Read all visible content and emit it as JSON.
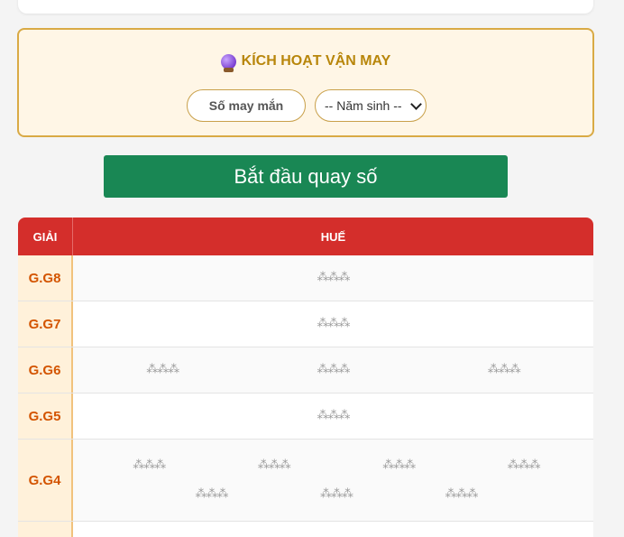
{
  "lucky": {
    "title": "KÍCH HOẠT VẬN MAY",
    "icon": "crystal-ball-icon",
    "lucky_number_placeholder": "Số may mắn",
    "birth_year_selected": "-- Năm sinh --"
  },
  "spin_button_label": "Bắt đầu quay số",
  "results": {
    "col_prize": "GIẢI",
    "col_province": "HUẾ",
    "loading_glyph": "⁂⁂⁂",
    "rows": [
      {
        "prize": "G.G8",
        "slots": 1
      },
      {
        "prize": "G.G7",
        "slots": 1
      },
      {
        "prize": "G.G6",
        "slots": 3
      },
      {
        "prize": "G.G5",
        "slots": 1
      },
      {
        "prize": "G.G4",
        "slots": 7
      }
    ]
  },
  "colors": {
    "accent_green": "#198754",
    "header_red": "#d42e2b",
    "gold": "#b8860b",
    "prize_orange": "#d35400"
  }
}
